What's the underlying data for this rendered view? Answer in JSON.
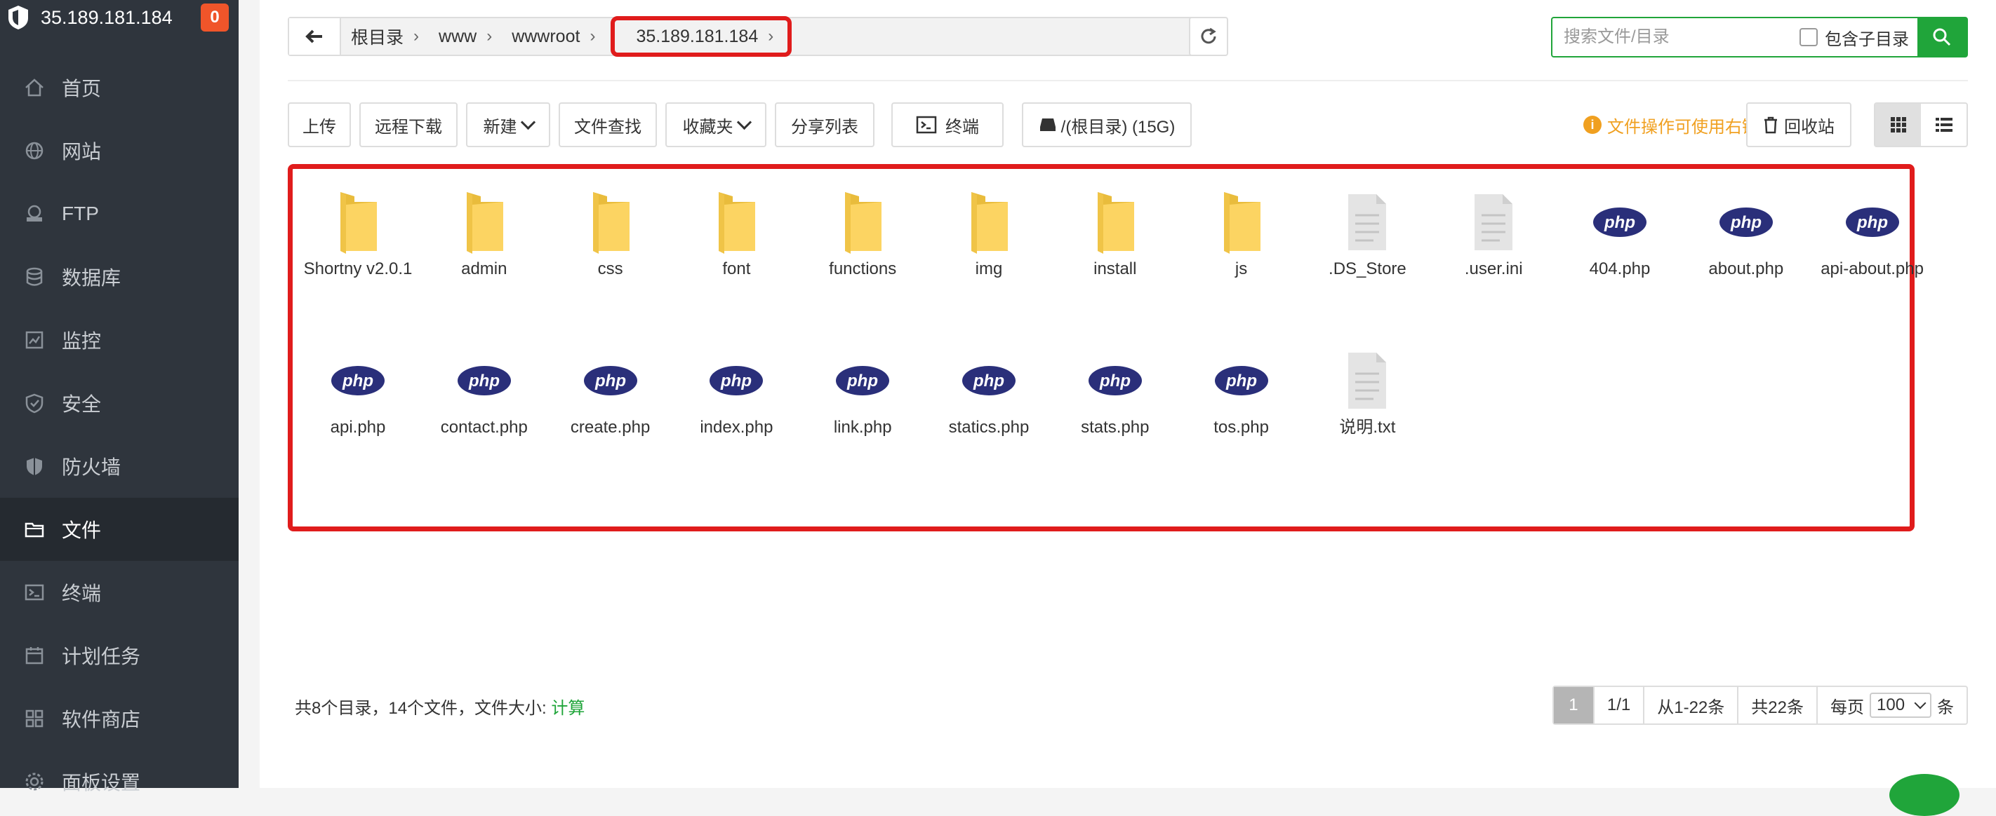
{
  "sidebar": {
    "ip": "35.189.181.184",
    "badge": "0",
    "items": [
      {
        "label": "首页",
        "icon": "home-icon"
      },
      {
        "label": "网站",
        "icon": "globe-icon"
      },
      {
        "label": "FTP",
        "icon": "ftp-icon"
      },
      {
        "label": "数据库",
        "icon": "database-icon"
      },
      {
        "label": "监控",
        "icon": "monitor-icon"
      },
      {
        "label": "安全",
        "icon": "shield-icon"
      },
      {
        "label": "防火墙",
        "icon": "firewall-icon"
      },
      {
        "label": "文件",
        "icon": "folder-icon",
        "active": true
      },
      {
        "label": "终端",
        "icon": "terminal-icon"
      },
      {
        "label": "计划任务",
        "icon": "calendar-icon"
      },
      {
        "label": "软件商店",
        "icon": "apps-icon"
      },
      {
        "label": "面板设置",
        "icon": "gear-icon"
      }
    ]
  },
  "path": {
    "crumbs": [
      "根目录",
      "www",
      "wwwroot"
    ],
    "current": "35.189.181.184"
  },
  "search": {
    "placeholder": "搜索文件/目录",
    "include_sub": "包含子目录"
  },
  "toolbar": {
    "upload": "上传",
    "remote_download": "远程下载",
    "new": "新建",
    "find": "文件查找",
    "favorites": "收藏夹",
    "share_list": "分享列表",
    "terminal": "终端",
    "disk": "/(根目录) (15G)",
    "tip": "文件操作可使用右键",
    "recycle": "回收站"
  },
  "files": [
    {
      "name": "Shortny v2.0.1",
      "type": "folder"
    },
    {
      "name": "admin",
      "type": "folder"
    },
    {
      "name": "css",
      "type": "folder"
    },
    {
      "name": "font",
      "type": "folder"
    },
    {
      "name": "functions",
      "type": "folder"
    },
    {
      "name": "img",
      "type": "folder"
    },
    {
      "name": "install",
      "type": "folder"
    },
    {
      "name": "js",
      "type": "folder"
    },
    {
      "name": ".DS_Store",
      "type": "doc"
    },
    {
      "name": ".user.ini",
      "type": "doc"
    },
    {
      "name": "404.php",
      "type": "php"
    },
    {
      "name": "about.php",
      "type": "php"
    },
    {
      "name": "api-about.php",
      "type": "php"
    },
    {
      "name": "api.php",
      "type": "php"
    },
    {
      "name": "contact.php",
      "type": "php"
    },
    {
      "name": "create.php",
      "type": "php"
    },
    {
      "name": "index.php",
      "type": "php"
    },
    {
      "name": "link.php",
      "type": "php"
    },
    {
      "name": "statics.php",
      "type": "php"
    },
    {
      "name": "stats.php",
      "type": "php"
    },
    {
      "name": "tos.php",
      "type": "php"
    },
    {
      "name": "说明.txt",
      "type": "doc"
    }
  ],
  "summary": {
    "text": "共8个目录，14个文件，文件大小: ",
    "calc": "计算"
  },
  "pager": {
    "current": "1",
    "pages": "1/1",
    "range": "从1-22条",
    "total": "共22条",
    "per_page_label": "每页",
    "per_page": "100",
    "unit": "条"
  }
}
